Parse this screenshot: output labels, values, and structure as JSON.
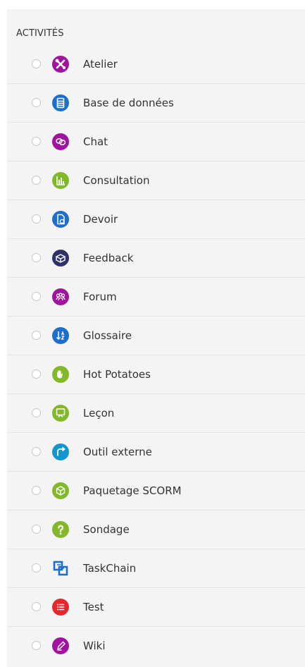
{
  "section_title": "ACTIVITÉS",
  "activities": [
    {
      "label": "Atelier",
      "icon": "workshop-tools-icon",
      "color": "#a0139e"
    },
    {
      "label": "Base de données",
      "icon": "database-icon",
      "color": "#1d6fce"
    },
    {
      "label": "Chat",
      "icon": "chat-bubbles-icon",
      "color": "#a0139e"
    },
    {
      "label": "Consultation",
      "icon": "bar-chart-icon",
      "color": "#83b82a"
    },
    {
      "label": "Devoir",
      "icon": "assignment-document-icon",
      "color": "#1d6fce"
    },
    {
      "label": "Feedback",
      "icon": "feedback-megaphone-icon",
      "color": "#2d3166"
    },
    {
      "label": "Forum",
      "icon": "people-group-icon",
      "color": "#a0139e"
    },
    {
      "label": "Glossaire",
      "icon": "sort-az-icon",
      "color": "#1d6fce"
    },
    {
      "label": "Hot Potatoes",
      "icon": "hand-icon",
      "color": "#83b82a"
    },
    {
      "label": "Leçon",
      "icon": "presentation-board-icon",
      "color": "#83b82a"
    },
    {
      "label": "Outil externe",
      "icon": "external-share-icon",
      "color": "#1396cf"
    },
    {
      "label": "Paquetage SCORM",
      "icon": "package-cube-icon",
      "color": "#83b82a"
    },
    {
      "label": "Sondage",
      "icon": "question-mark-icon",
      "color": "#83b82a"
    },
    {
      "label": "TaskChain",
      "icon": "chain-squares-icon",
      "color": "#1d6fce"
    },
    {
      "label": "Test",
      "icon": "checklist-icon",
      "color": "#e8262c"
    },
    {
      "label": "Wiki",
      "icon": "pencil-icon",
      "color": "#a0139e"
    }
  ]
}
